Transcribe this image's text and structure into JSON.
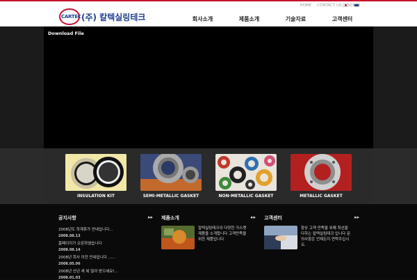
{
  "header": {
    "logo_mark": "CARTEC",
    "company": "(주) 칼텍실링테크",
    "util_links": [
      "HOME",
      "CONTACT US",
      "ADMIN"
    ],
    "nav": [
      "회사소개",
      "제품소개",
      "기술자료",
      "고객센터"
    ]
  },
  "stage": {
    "download_label": "Download File"
  },
  "products": [
    {
      "label": "INSULATION KIT"
    },
    {
      "label": "SEMI-METALLIC GASKET"
    },
    {
      "label": "NON-METALLIC GASKET"
    },
    {
      "label": "METALLIC GASKET"
    }
  ],
  "notice": {
    "title": "공지사항",
    "items": [
      {
        "text": "2008년도 하계휴가 안내입니다...",
        "date": "2008.08.13"
      },
      {
        "text": "홈페이지가 오픈하였습니다",
        "date": "2008.08.14"
      },
      {
        "text": "2008년 회사 이전 안내입니다 ......",
        "date": "2008.05.06"
      },
      {
        "text": "2008년 신년 새 복 많이 받으세요!...",
        "date": "2008.01.03"
      }
    ]
  },
  "product_news": {
    "title": "제품소개",
    "text": "칼텍실링테크의 다양한 가스켓 제품을 소개합니다 고객만족을 위한 제품입니다"
  },
  "support": {
    "title": "고객센터",
    "text": "항상 고객 만족을 위해 최선을 다하는 칼텍실링테크 입니다 문의사항은 언제든지 연락주십시오."
  },
  "more_label": "▸▸"
}
